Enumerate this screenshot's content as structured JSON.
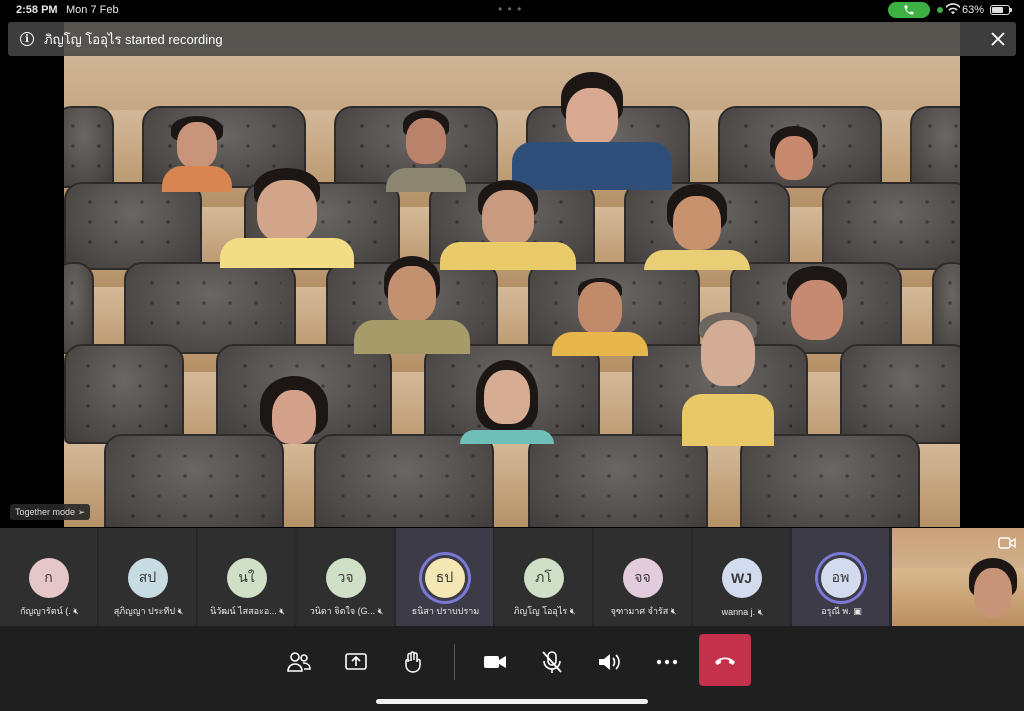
{
  "status_bar": {
    "time": "2:58 PM",
    "date": "Mon 7 Feb",
    "battery": "63%"
  },
  "banner": {
    "text": "ภิญโญ  โออุไร started recording"
  },
  "stage": {
    "mode_label": "Together mode"
  },
  "participants": [
    {
      "initials": "ก",
      "name": "กัญญารัตน์ (.",
      "avatar_color": "#e6c7c8",
      "muted": true
    },
    {
      "initials": "สป",
      "name": "สุภิญญา ประทีป",
      "avatar_color": "#c7dbe3",
      "muted": true
    },
    {
      "initials": "นใ",
      "name": "นิวัฒน์ ไสสอะอ...",
      "avatar_color": "#cfe0c6",
      "muted": true
    },
    {
      "initials": "วจ",
      "name": "วนิดา จิตใจ (G...",
      "avatar_color": "#cfe0c6",
      "muted": true
    },
    {
      "initials": "ธป",
      "name": "ธนิสา ปราบปราม",
      "avatar_color": "#f5e7b4",
      "muted": false,
      "active": true
    },
    {
      "initials": "ภโ",
      "name": "ภิญโญ  โออุไร",
      "avatar_color": "#cfe0c6",
      "muted": true
    },
    {
      "initials": "จจ",
      "name": "จุฑามาศ จำรัส",
      "avatar_color": "#e3cddc",
      "muted": true
    },
    {
      "initials": "WJ",
      "name": "wanna j.",
      "avatar_color": "#d3dcef",
      "muted": true
    },
    {
      "initials": "อพ",
      "name": "อรุณี พ.",
      "avatar_color": "#d3dcef",
      "muted": false,
      "active": true
    }
  ],
  "controls": {
    "people": "people-icon",
    "share": "share-icon",
    "reactions": "raise-hand-icon",
    "camera": "camera-icon",
    "mic": "mic-off-icon",
    "speaker": "speaker-icon",
    "more": "more-icon",
    "hangup": "hangup-icon",
    "hangup_color": "#c4314b"
  }
}
